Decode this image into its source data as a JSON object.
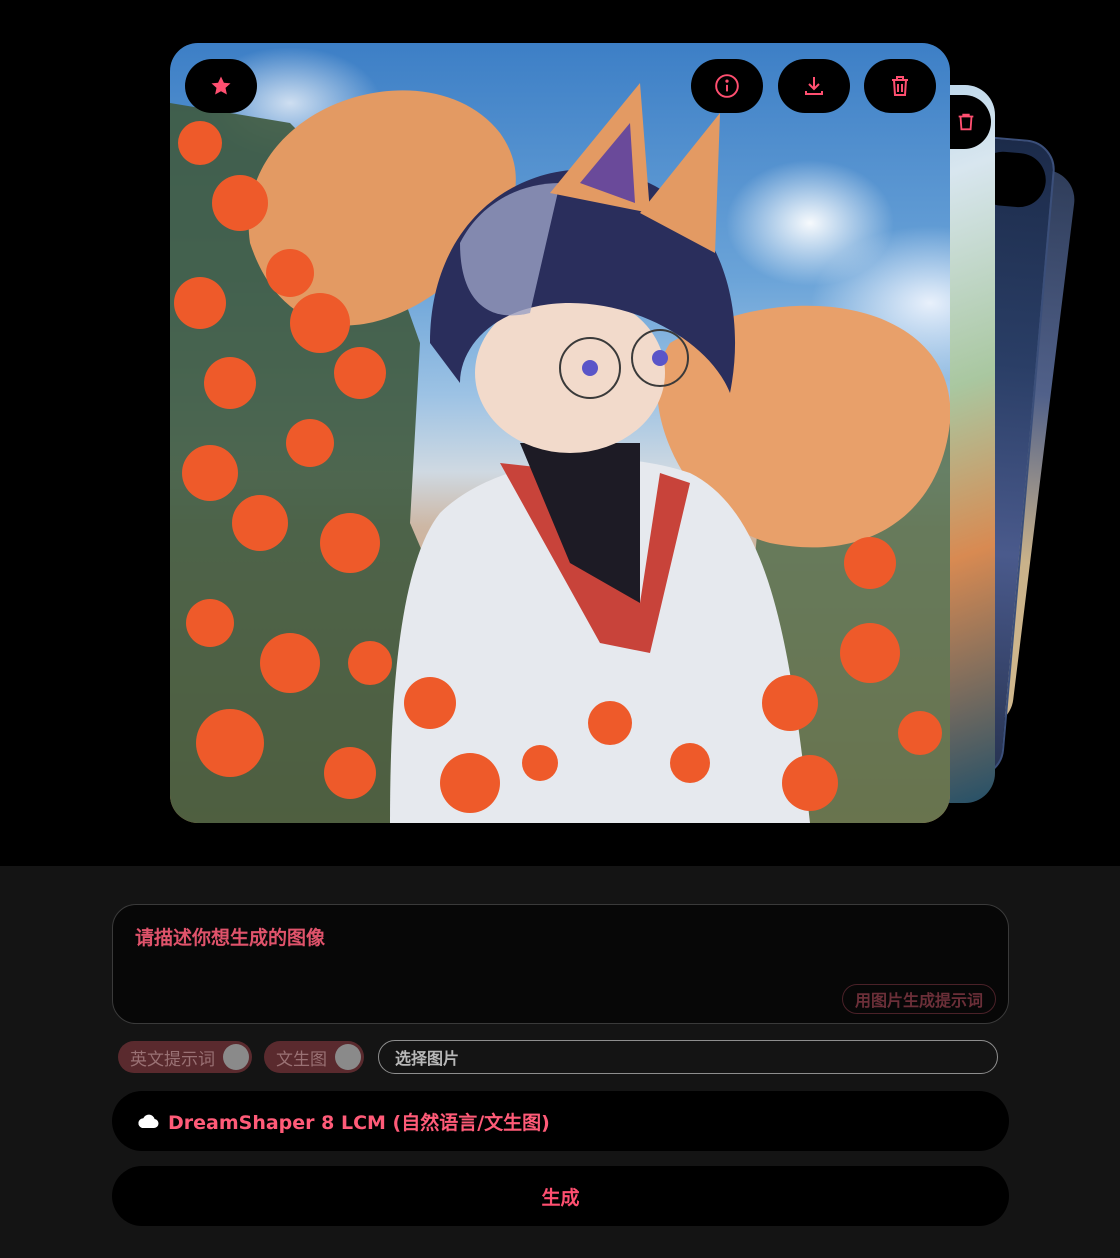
{
  "gallery": {
    "main_image_alt": "",
    "accent_color": "#ff4f70"
  },
  "toolbar": {
    "favorite_icon": "star-icon",
    "info_icon": "info-icon",
    "download_icon": "download-icon",
    "delete_icon": "trash-icon"
  },
  "prompt": {
    "placeholder": "请描述你想生成的图像",
    "image_to_prompt_label": "用图片生成提示词"
  },
  "options": {
    "english_prompt_label": "英文提示词",
    "text_to_image_label": "文生图",
    "choose_image_label": "选择图片"
  },
  "model": {
    "icon": "cloud-icon",
    "label": "DreamShaper 8 LCM (自然语言/文生图)"
  },
  "actions": {
    "generate_label": "生成"
  }
}
